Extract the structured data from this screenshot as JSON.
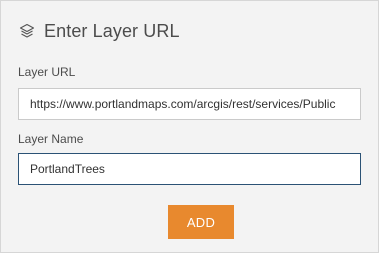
{
  "dialog": {
    "title": "Enter Layer URL",
    "icon": "layers-icon"
  },
  "form": {
    "url_label": "Layer URL",
    "url_value": "https://www.portlandmaps.com/arcgis/rest/services/Public",
    "name_label": "Layer Name",
    "name_value": "PortlandTrees"
  },
  "actions": {
    "add_label": "ADD"
  },
  "colors": {
    "accent": "#e8892e",
    "focus_border": "#2b5275",
    "panel_bg": "#f3f3f3"
  }
}
